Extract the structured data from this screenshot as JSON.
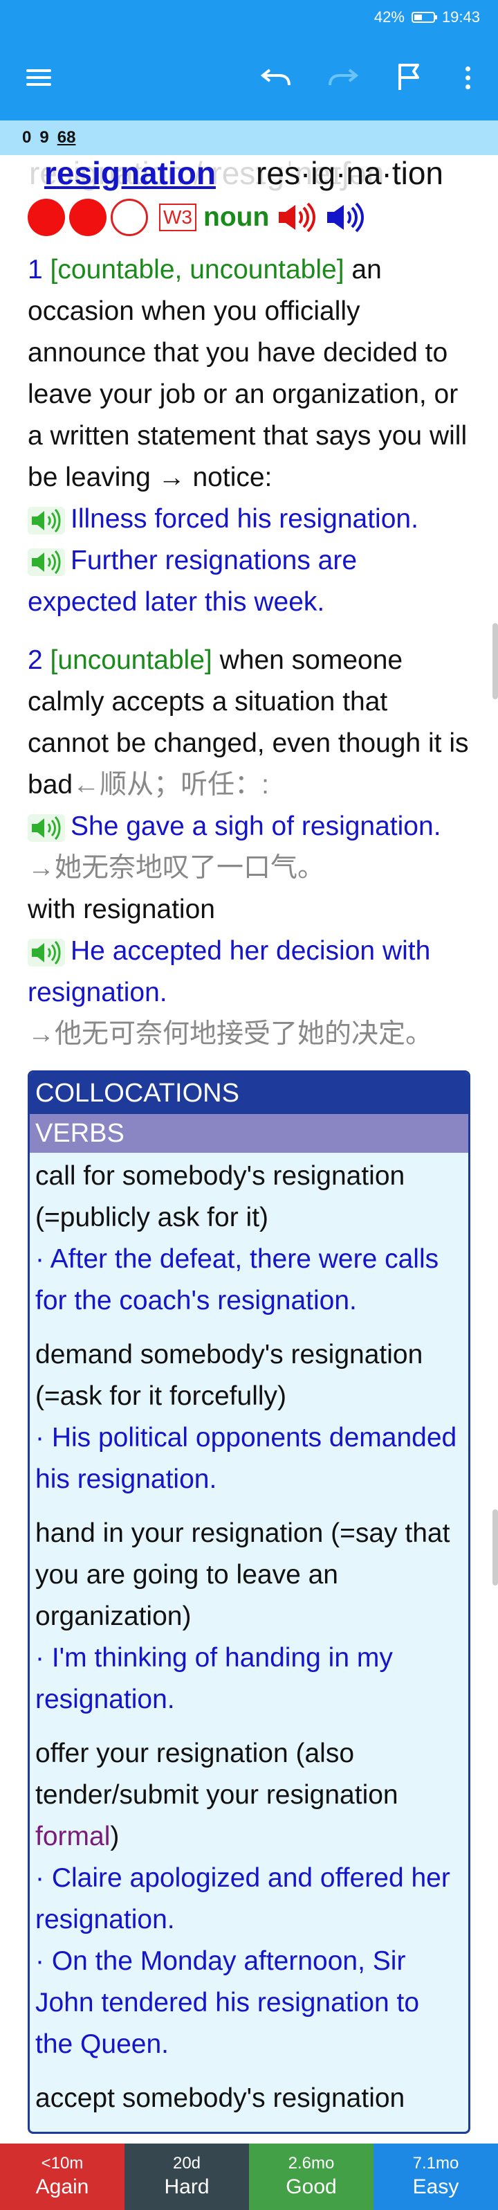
{
  "status": {
    "battery": "42%",
    "time": "19:43"
  },
  "progress": {
    "new": "0",
    "learning": "9",
    "review": "68"
  },
  "entry": {
    "ghost": "resignation / resɪɡˈneɪʃən",
    "word": "resignation",
    "pronunciation": "res·ig·na·tion",
    "frequency_level": "W3",
    "pos": "noun"
  },
  "senses": [
    {
      "num": "1",
      "gram": "[countable, uncountable]",
      "definition": " an occasion when you officially announce that you have decided to leave your job or an organization, or a written statement that says you will be leaving → notice:",
      "examples": [
        "Illness forced his resignation.",
        "Further resignations are expected later this week."
      ]
    },
    {
      "num": "2",
      "gram": "[uncountable]",
      "definition": " when someone calmly accepts a situation that cannot be changed, even though it is bad",
      "definition_cn": "←顺从；听任：:",
      "ex1": "She gave a sigh of resignation.",
      "ex1_cn": "→她无奈地叹了一口气。",
      "phrase": "with resignation",
      "ex2": "He accepted her decision with resignation.",
      "ex2_cn": "→他无可奈何地接受了她的决定。"
    }
  ],
  "collocations": {
    "title": "COLLOCATIONS",
    "subtitle": "VERBS",
    "items": [
      {
        "phrase": "call for somebody's resignation (=publicly ask for it)",
        "examples": [
          "· After the defeat, there were calls for the coach's resignation."
        ]
      },
      {
        "phrase": "demand somebody's resignation (=ask for it forcefully)",
        "examples": [
          "· His political opponents demanded his resignation."
        ]
      },
      {
        "phrase": "hand in your resignation (=say that you are going to leave an organization)",
        "examples": [
          "· I'm thinking of handing in my resignation."
        ]
      },
      {
        "phrase_a": "offer your resignation (also tender/submit your resignation ",
        "phrase_formal": "formal",
        "phrase_b": ")",
        "examples": [
          "· Claire apologized and offered her resignation.",
          "· On the Monday afternoon, Sir John tendered his resignation to the Queen."
        ]
      },
      {
        "phrase": "accept somebody's resignation",
        "examples": []
      }
    ]
  },
  "answers": [
    {
      "time": "<10m",
      "label": "Again",
      "color": "#d32f2f"
    },
    {
      "time": "20d",
      "label": "Hard",
      "color": "#37474f"
    },
    {
      "time": "2.6mo",
      "label": "Good",
      "color": "#43a047"
    },
    {
      "time": "7.1mo",
      "label": "Easy",
      "color": "#1e88e5"
    }
  ]
}
